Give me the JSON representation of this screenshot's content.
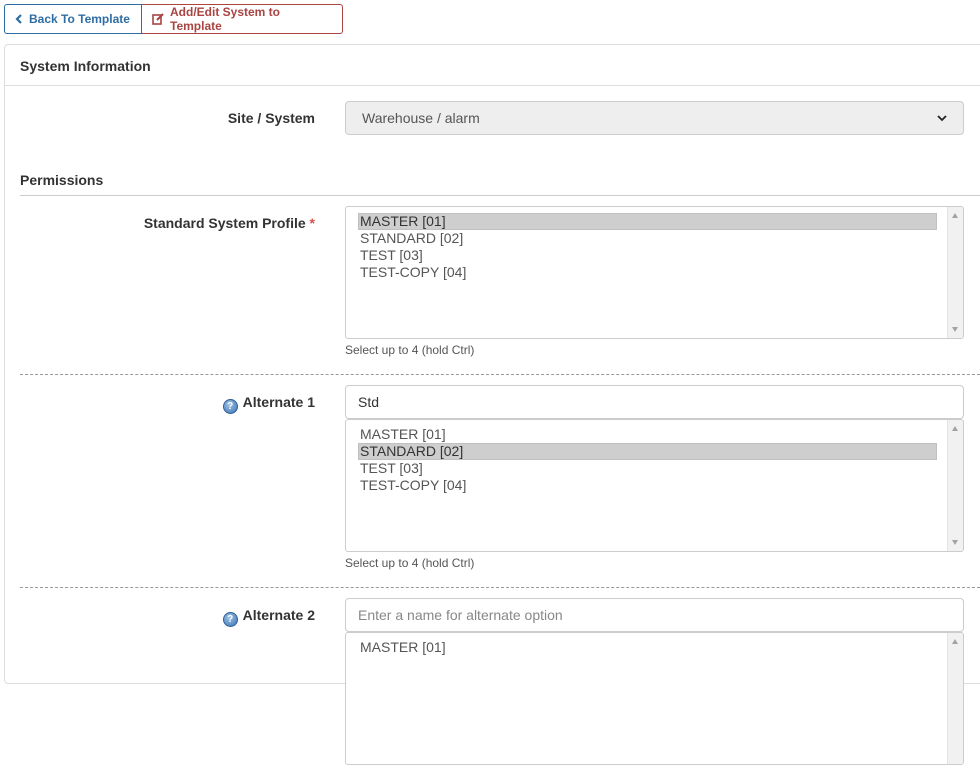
{
  "toolbar": {
    "back_label": "Back To Template",
    "add_edit_label": "Add/Edit System to Template"
  },
  "panel": {
    "title": "System Information"
  },
  "site_system": {
    "label": "Site / System",
    "selected": "Warehouse / alarm"
  },
  "permissions": {
    "title": "Permissions"
  },
  "standard_profile": {
    "label": "Standard System Profile",
    "required_mark": "*",
    "options": [
      "MASTER [01]",
      "STANDARD [02]",
      "TEST [03]",
      "TEST-COPY [04]"
    ],
    "selected_index": 0,
    "hint": "Select up to 4 (hold Ctrl)"
  },
  "alternate1": {
    "label": "Alternate 1",
    "name_value": "Std",
    "name_placeholder": "Enter a name for alternate option",
    "options": [
      "MASTER [01]",
      "STANDARD [02]",
      "TEST [03]",
      "TEST-COPY [04]"
    ],
    "selected_index": 1,
    "hint": "Select up to 4 (hold Ctrl)"
  },
  "alternate2": {
    "label": "Alternate 2",
    "name_value": "",
    "name_placeholder": "Enter a name for alternate option",
    "options": [
      "MASTER [01]"
    ]
  },
  "icons": {
    "back": "chevron-left-icon",
    "edit": "edit-icon",
    "help": "question-circle-icon",
    "dropdown": "chevron-down-icon"
  },
  "colors": {
    "primary": "#2e6da4",
    "danger": "#a94442",
    "required": "#d9534f"
  }
}
